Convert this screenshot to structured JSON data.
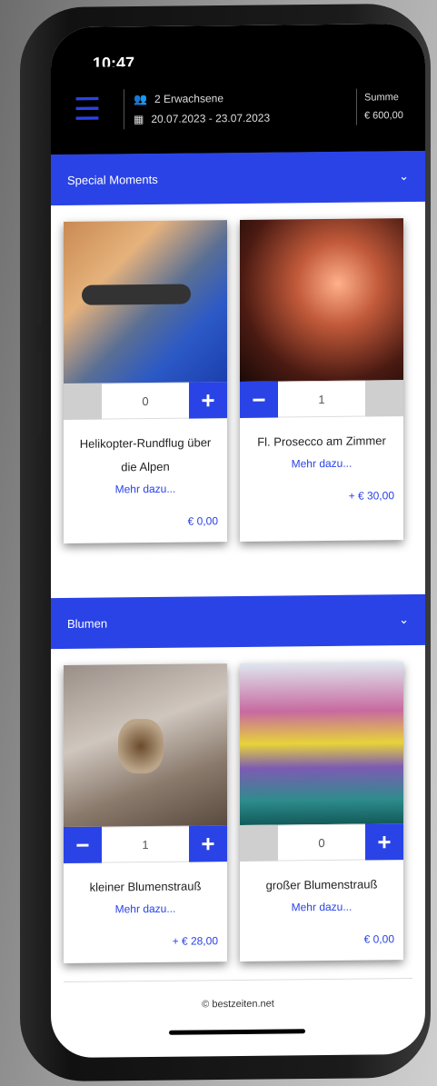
{
  "status": {
    "time": "10:47",
    "icons": "signal-wifi-battery"
  },
  "topbar": {
    "guests": "2 Erwachsene",
    "dates": "20.07.2023 - 23.07.2023",
    "sum_label": "Summe",
    "sum_value": "€ 600,00"
  },
  "sections": [
    {
      "title": "Special Moments",
      "cards": [
        {
          "title": "Helikopter-Rundflug über die Alpen",
          "more": "Mehr dazu...",
          "qty": "0",
          "price": "€ 0,00"
        },
        {
          "title": "Fl. Prosecco am Zimmer",
          "more": "Mehr dazu...",
          "qty": "1",
          "price": "+ € 30,00"
        }
      ]
    },
    {
      "title": "Blumen",
      "cards": [
        {
          "title": "kleiner Blumenstrauß",
          "more": "Mehr dazu...",
          "qty": "1",
          "price": "+ € 28,00"
        },
        {
          "title": "großer Blumenstrauß",
          "more": "Mehr dazu...",
          "qty": "0",
          "price": "€ 0,00"
        }
      ]
    }
  ],
  "footer": {
    "text": "© bestzeiten.net"
  },
  "colors": {
    "accent": "#2a43e6",
    "bar": "#000000"
  }
}
